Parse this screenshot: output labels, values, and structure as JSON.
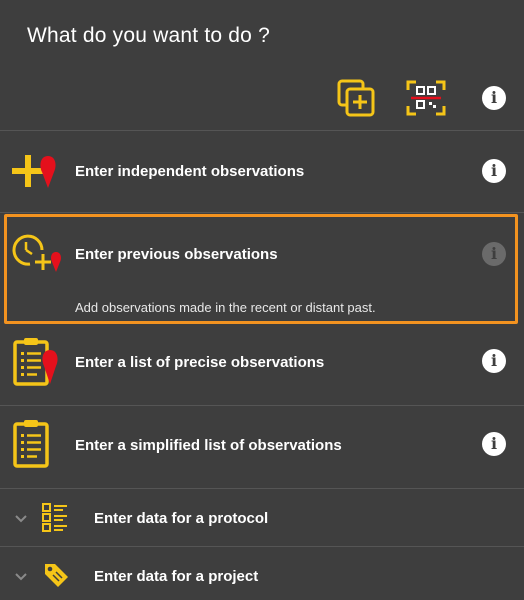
{
  "header": {
    "title": "What do you want to do ?"
  },
  "toolbar": {
    "add_icon": "add-copy-icon",
    "qr_icon": "qr-scan-icon",
    "info_icon": "info-icon"
  },
  "rows": [
    {
      "label": "Enter independent observations",
      "icon": "plus-pin-icon"
    },
    {
      "label": "Enter previous observations",
      "description": "Add observations made in the recent or distant past.",
      "icon": "clock-plus-pin-icon"
    },
    {
      "label": "Enter a list of precise observations",
      "icon": "clipboard-pin-icon"
    },
    {
      "label": "Enter a simplified list of observations",
      "icon": "clipboard-icon"
    }
  ],
  "expandables": [
    {
      "label": "Enter data for a protocol",
      "icon": "checklist-icon"
    },
    {
      "label": "Enter data for a project",
      "icon": "tag-icon"
    }
  ],
  "colors": {
    "background": "#3e3e3e",
    "accent_yellow": "#f5c518",
    "pin_red": "#e4101c",
    "highlight_orange": "#f39320"
  }
}
